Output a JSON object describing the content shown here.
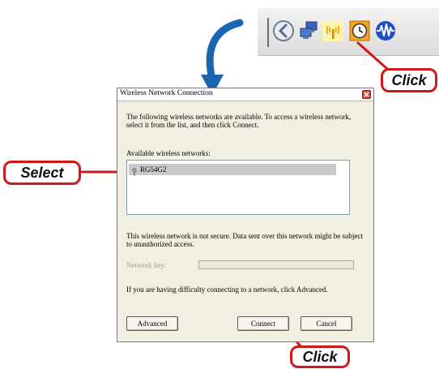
{
  "dialog": {
    "title": "Wireless Network Connection",
    "intro": "The following wireless networks are available. To access a wireless network, select it from the list, and then click Connect.",
    "available_label": "Available wireless networks:",
    "networks": [
      {
        "name": "RG54G2",
        "selected": true
      }
    ],
    "security_warning": "This wireless network is not secure. Data sent over this network might be subject to unauthorized access.",
    "network_key_label": "Network key:",
    "network_key_value": "",
    "help_text": "If you are having difficulty connecting to a network, click Advanced.",
    "advanced_button": "Advanced",
    "connect_button": "Connect",
    "cancel_button": "Cancel"
  },
  "annotations": {
    "tray_click": "Click",
    "select": "Select",
    "connect_click": "Click"
  },
  "tray": {
    "icons": [
      "back-arrow-icon",
      "network-computers-icon",
      "wireless-signal-icon",
      "clock-icon",
      "waveform-icon"
    ]
  },
  "colors": {
    "callout_border": "#d01818",
    "arrow": "#1b66b0",
    "dialog_bg": "#f1efe2",
    "close_button": "#d9463b"
  }
}
